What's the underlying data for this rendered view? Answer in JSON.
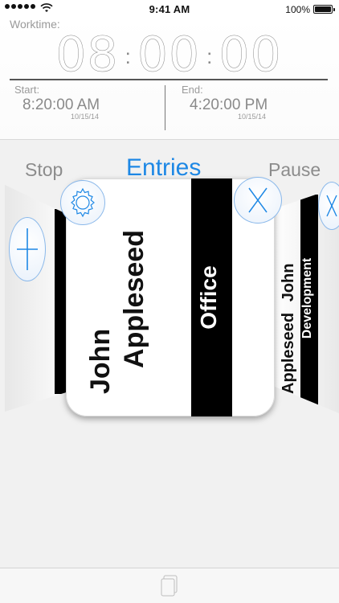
{
  "status_bar": {
    "time": "9:41 AM",
    "battery_percent": "100%",
    "battery_level": 1.0
  },
  "timer": {
    "label": "Worktime:",
    "hours": "08",
    "minutes": "00",
    "seconds": "00",
    "separator": ":"
  },
  "start": {
    "label": "Start:",
    "time": "8:20:00 AM",
    "date": "10/15/14"
  },
  "end": {
    "label": "End:",
    "time": "4:20:00 PM",
    "date": "10/15/14"
  },
  "actions": {
    "stop": "Stop",
    "entries": "Entries",
    "pause": "Pause"
  },
  "cards": {
    "main": {
      "first_name": "John",
      "last_name": "Appleseed",
      "category": "Office"
    },
    "right": {
      "first_name": "John",
      "last_name": "Appleseed",
      "category": "Development"
    }
  },
  "icons": {
    "add": "plus-icon",
    "settings": "gear-icon",
    "close": "close-icon",
    "documents": "documents-icon"
  },
  "colors": {
    "accent": "#1e88e5",
    "muted_text": "#8a8a8a",
    "strip": "#000000"
  }
}
